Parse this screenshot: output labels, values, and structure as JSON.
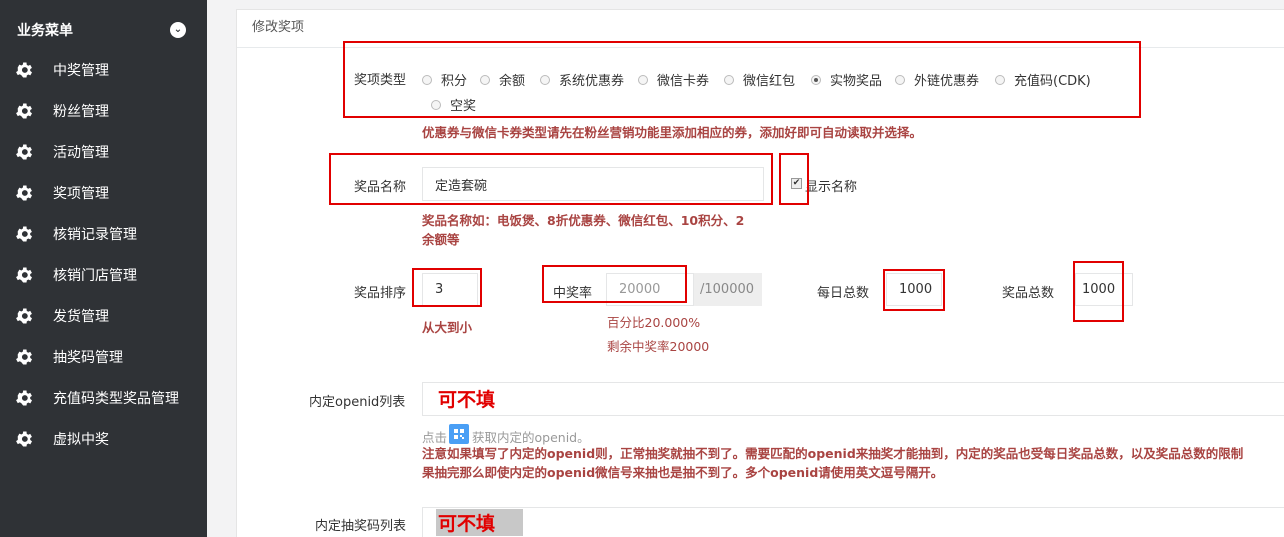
{
  "sidebar": {
    "header": "业务菜单",
    "items": [
      {
        "label": "中奖管理"
      },
      {
        "label": "粉丝管理"
      },
      {
        "label": "活动管理"
      },
      {
        "label": "奖项管理"
      },
      {
        "label": "核销记录管理"
      },
      {
        "label": "核销门店管理"
      },
      {
        "label": "发货管理"
      },
      {
        "label": "抽奖码管理"
      },
      {
        "label": "充值码类型奖品管理"
      },
      {
        "label": "虚拟中奖"
      }
    ]
  },
  "panel": {
    "title": "修改奖项",
    "prize_type": {
      "label": "奖项类型",
      "options": [
        "积分",
        "余额",
        "系统优惠券",
        "微信卡券",
        "微信红包",
        "实物奖品",
        "外链优惠券",
        "充值码(CDK)",
        "空奖"
      ],
      "selected": "实物奖品",
      "hint": "优惠券与微信卡券类型请先在粉丝营销功能里添加相应的券，添加好即可自动读取并选择。"
    },
    "prize_name": {
      "label": "奖品名称",
      "value": "定造套碗",
      "show_name_label": "显示名称",
      "show_name_checked": true,
      "hint_line1": "奖品名称如：电饭煲、8折优惠券、微信红包、10积分、2",
      "hint_line2": "余额等"
    },
    "sort": {
      "label": "奖品排序",
      "value": "3",
      "hint": "从大到小"
    },
    "win_rate": {
      "label": "中奖率",
      "value": "20000",
      "suffix": "/100000",
      "percent_text": "百分比20.000%",
      "remain_text": "剩余中奖率20000"
    },
    "daily_total": {
      "label": "每日总数",
      "value": "1000"
    },
    "prize_total": {
      "label": "奖品总数",
      "value": "1000"
    },
    "openid": {
      "label": "内定openid列表",
      "annotation": "可不填",
      "click_prefix": "点击",
      "click_suffix": "获取内定的openid。",
      "note_line1": "注意如果填写了内定的openid则，正常抽奖就抽不到了。需要匹配的openid来抽奖才能抽到，内定的奖品也受每日奖品总数，以及奖品总数的限制",
      "note_line2": "果抽完那么即使内定的openid微信号来抽也是抽不到了。多个openid请使用英文逗号隔开。"
    },
    "code_list": {
      "label": "内定抽奖码列表",
      "annotation": "可不填"
    }
  },
  "colors": {
    "sidebar_bg": "#2f3236",
    "annotation_red": "#e10000",
    "hint_red": "#a94442"
  }
}
